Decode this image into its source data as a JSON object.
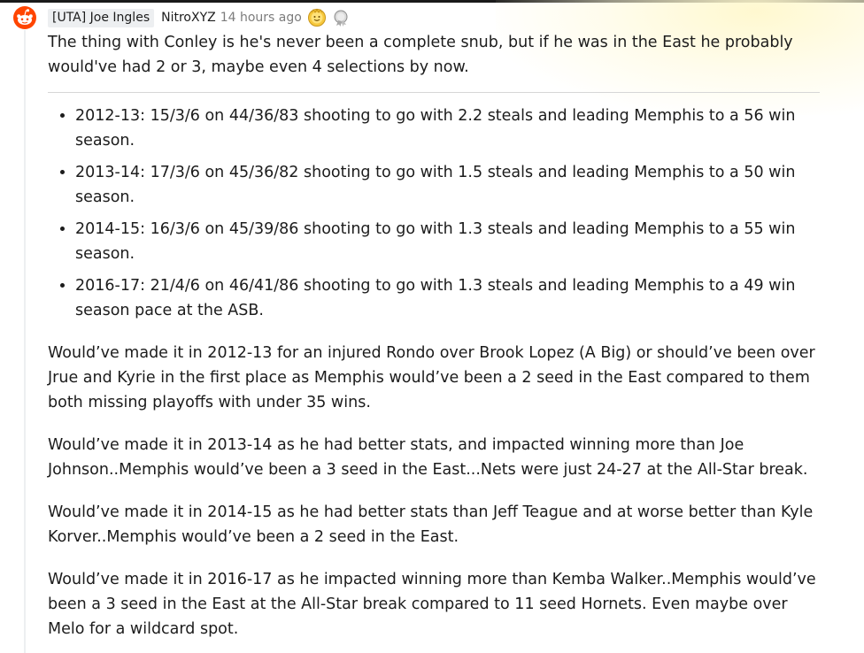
{
  "comment": {
    "flair": "[UTA] Joe Ingles",
    "author": "NitroXYZ",
    "timestamp": "14 hours ago",
    "awards": [
      {
        "icon": "helpful-award-icon"
      },
      {
        "icon": "silver-award-icon"
      }
    ],
    "intro": "The thing with Conley is he's never been a complete snub, but if he was in the East he probably would've had 2 or 3, maybe even 4 selections by now.",
    "stats": [
      "2012-13: 15/3/6 on 44/36/83 shooting to go with 2.2 steals and leading Memphis to a 56 win season.",
      "2013-14: 17/3/6 on 45/36/82 shooting to go with 1.5 steals and leading Memphis to a 50 win season.",
      "2014-15: 16/3/6 on 45/39/86 shooting to go with 1.3 steals and leading Memphis to a 55 win season.",
      "2016-17: 21/4/6 on 46/41/86 shooting to go with 1.3 steals and leading Memphis to a 49 win season pace at the ASB."
    ],
    "paragraphs": [
      "Would’ve made it in 2012-13 for an injured Rondo over Brook Lopez (A Big) or should’ve been over Jrue and Kyrie in the first place as Memphis would’ve been a 2 seed in the East compared to them both missing playoffs with under 35 wins.",
      "Would’ve made it in 2013-14 as he had better stats, and impacted winning more than Joe Johnson..Memphis would’ve been a 3 seed in the East...Nets were just 24-27 at the All-Star break.",
      "Would’ve made it in 2014-15 as he had better stats than Jeff Teague and at worse better than Kyle Korver..Memphis would’ve been a 2 seed in the East.",
      "Would’ve made it in 2016-17 as he impacted winning more than Kemba Walker..Memphis would’ve been a 3 seed in the East at the All-Star break compared to 11 seed Hornets. Even maybe over Melo for a wildcard spot."
    ]
  },
  "colors": {
    "avatar": "#ff4500",
    "thread_line": "#edeff1",
    "flair_bg": "#edeff1",
    "meta_text": "#7c7c7c",
    "body_text": "#1c1c1c"
  }
}
